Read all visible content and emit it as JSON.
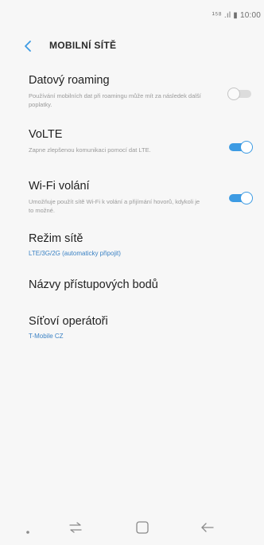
{
  "status_bar": {
    "text": "¹⁵⁸ .ıl ▮ 10:00"
  },
  "header": {
    "title": "MOBILNÍ SÍTĚ"
  },
  "settings": [
    {
      "title": "Datový roaming",
      "description": "Používání mobilních dat při roamingu může mít za následek další poplatky.",
      "toggle": false
    },
    {
      "title": "VoLTE",
      "description": "Zapne zlepšenou komunikaci pomocí dat LTE.",
      "toggle": true
    },
    {
      "title": "Wi-Fi volání",
      "description": "Umožňuje použít sítě Wi-Fi k volání a přijímání hovorů, kdykoli je to možné.",
      "toggle": true
    },
    {
      "title": "Režim sítě",
      "subtitle": "LTE/3G/2G (automaticky připojit)"
    },
    {
      "title": "Názvy přístupových bodů"
    },
    {
      "title": "Síťoví operátoři",
      "subtitle": "T-Mobile CZ"
    }
  ],
  "icons": {
    "back": "chevron-left-icon",
    "nav_dot": "dot-icon",
    "recent_apps": "recent-apps-icon",
    "home": "home-icon",
    "back_nav": "back-arrow-icon"
  },
  "colors": {
    "accent": "#3d9be3",
    "link": "#3b82c4",
    "background": "#f7f7f7"
  }
}
